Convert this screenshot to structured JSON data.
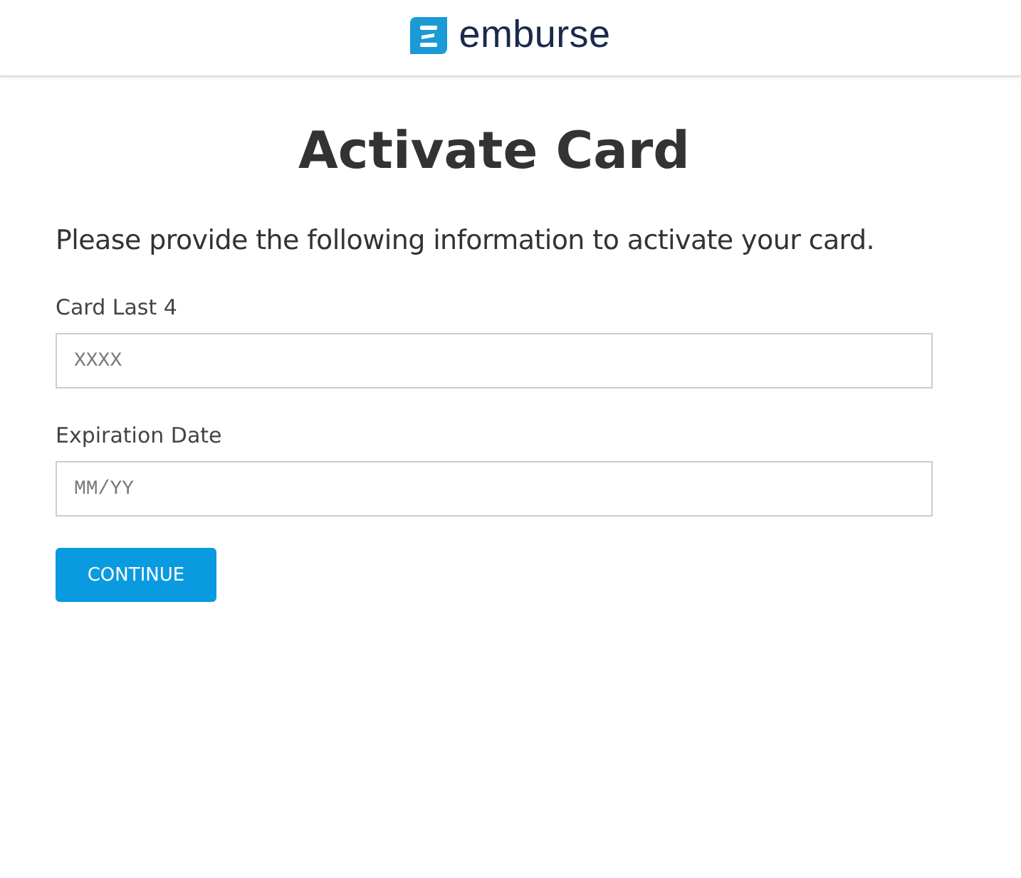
{
  "header": {
    "brand": "emburse"
  },
  "title": "Activate Card",
  "intro": "Please provide the following information to activate your card.",
  "fields": [
    {
      "label": "Card Last 4",
      "placeholder": "XXXX"
    },
    {
      "label": "Expiration Date",
      "placeholder": "MM/YY"
    }
  ],
  "button": "CONTINUE"
}
